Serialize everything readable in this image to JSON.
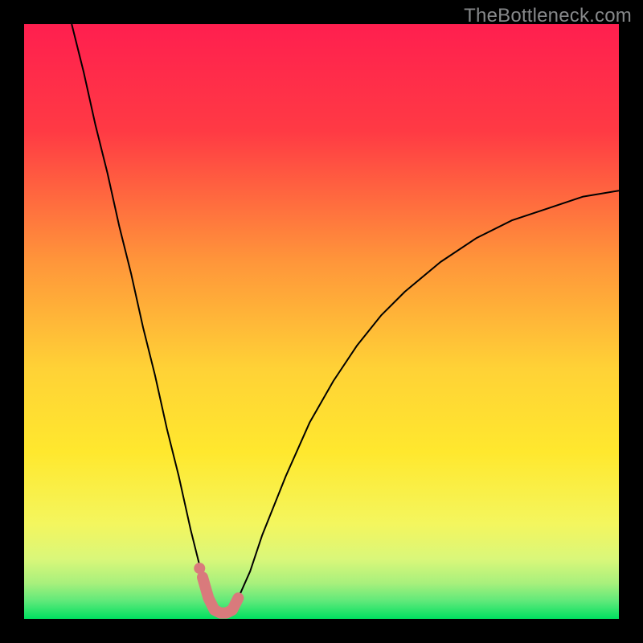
{
  "watermark": "TheBottleneck.com",
  "chart_data": {
    "type": "line",
    "title": "",
    "xlabel": "",
    "ylabel": "",
    "xlim": [
      0,
      100
    ],
    "ylim": [
      0,
      100
    ],
    "legend": false,
    "gradient_background": {
      "top": "#ff1f4f",
      "middle": "#ffe800",
      "bottom": "#00e060"
    },
    "series": [
      {
        "name": "bottleneck-curve",
        "color": "#000000",
        "stroke_width": 2,
        "x": [
          8,
          10,
          12,
          14,
          16,
          18,
          20,
          22,
          24,
          26,
          28,
          30,
          31,
          32,
          33,
          34,
          35,
          36,
          38,
          40,
          44,
          48,
          52,
          56,
          60,
          64,
          70,
          76,
          82,
          88,
          94,
          100
        ],
        "y": [
          100,
          92,
          83,
          75,
          66,
          58,
          49,
          41,
          32,
          24,
          15,
          7,
          3.5,
          1.5,
          1.0,
          1.0,
          1.5,
          3.5,
          8,
          14,
          24,
          33,
          40,
          46,
          51,
          55,
          60,
          64,
          67,
          69,
          71,
          72
        ]
      },
      {
        "name": "highlight-segment",
        "color": "#d97a7c",
        "stroke_width": 14,
        "linecap": "round",
        "x": [
          30,
          31,
          32,
          33,
          34,
          35,
          36
        ],
        "y": [
          7,
          3.5,
          1.5,
          1.0,
          1.0,
          1.5,
          3.5
        ]
      }
    ],
    "markers": [
      {
        "name": "dot-1",
        "x": 29.5,
        "y": 8.5,
        "r": 7,
        "color": "#d97a7c"
      }
    ]
  }
}
